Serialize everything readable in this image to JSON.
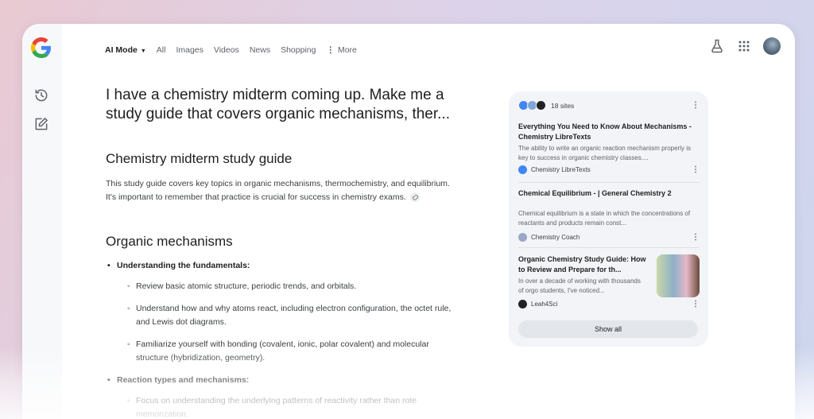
{
  "nav": {
    "tabs": [
      {
        "label": "AI Mode"
      },
      {
        "label": "All"
      },
      {
        "label": "Images"
      },
      {
        "label": "Videos"
      },
      {
        "label": "News"
      },
      {
        "label": "Shopping"
      },
      {
        "label": "More"
      }
    ]
  },
  "query": "I have a chemistry midterm coming up. Make me a study guide that covers organic mechanisms, ther...",
  "answer": {
    "heading": "Chemistry midterm study guide",
    "intro": "This study guide covers key topics in organic mechanisms, thermochemistry, and equilibrium. It's important to remember that practice is crucial for success in chemistry exams.",
    "section_heading": "Organic mechanisms",
    "bullets": [
      {
        "label": "Understanding the fundamentals:",
        "items": [
          "Review basic atomic structure, periodic trends, and orbitals.",
          "Understand how and why atoms react, including electron configuration, the octet rule, and Lewis dot diagrams.",
          "Familiarize yourself with bonding (covalent, ionic, polar covalent) and molecular structure (hybridization, geometry)."
        ]
      },
      {
        "label": "Reaction types and mechanisms:",
        "items": [
          "Focus on understanding the underlying patterns of reactivity rather than rote memorization."
        ]
      }
    ]
  },
  "sources": {
    "count_label": "18 sites",
    "cards": [
      {
        "title": "Everything You Need to Know About Mechanisms - Chemistry LibreTexts",
        "snippet": "The ability to write an organic reaction mechanism properly is key to success in organic chemistry classes....",
        "source": "Chemistry LibreTexts"
      },
      {
        "title": "Chemical Equilibrium - | General Chemistry 2",
        "snippet": "Chemical equilibrium is a state in which the concentrations of reactants and products remain const...",
        "source": "Chemistry Coach"
      },
      {
        "title": "Organic Chemistry Study Guide: How to Review and Prepare for th...",
        "snippet": "In over a decade of working with thousands of orgo students, I've noticed...",
        "source": "Leah4Sci"
      }
    ],
    "show_all_label": "Show all"
  },
  "colors": {
    "accent_blue": "#4285f4",
    "accent_red": "#ea4335",
    "accent_yellow": "#fbbc05",
    "accent_green": "#34a853"
  },
  "icons": {
    "logo": "google-g-logo",
    "history": "history-icon",
    "new_chat": "edit-icon",
    "labs": "flask-icon",
    "apps": "apps-grid-icon"
  }
}
